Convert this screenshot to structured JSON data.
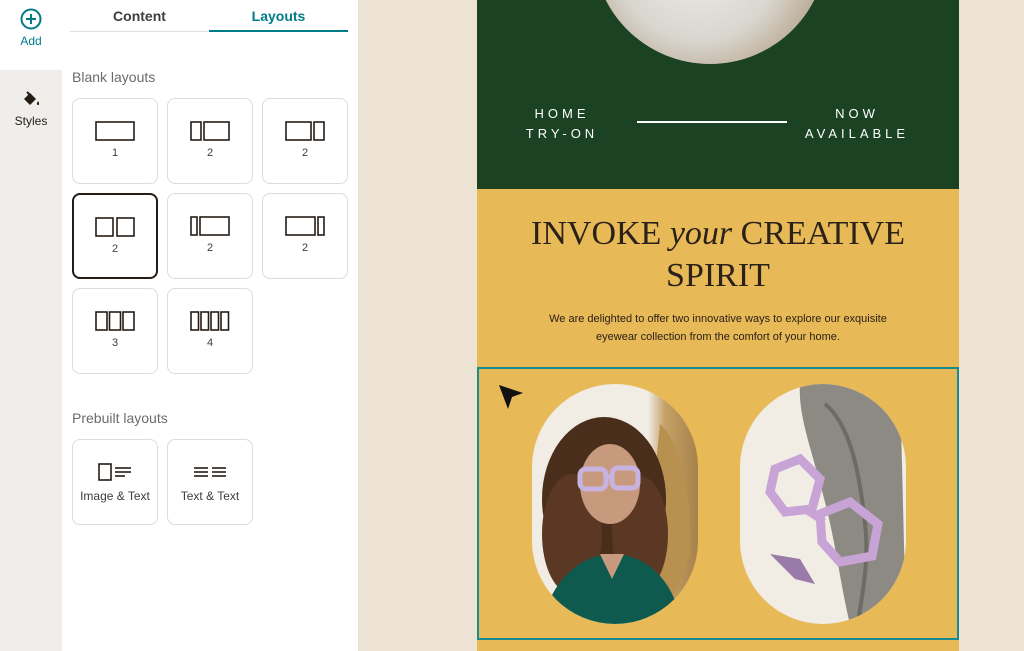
{
  "rail": {
    "add_label": "Add",
    "styles_label": "Styles",
    "accent": "#007c89"
  },
  "tabs": [
    {
      "label": "Content",
      "active": false
    },
    {
      "label": "Layouts",
      "active": true
    }
  ],
  "blank_layouts": {
    "title": "Blank layouts",
    "tiles": [
      {
        "label": "1",
        "icon": "layout-1-column-icon"
      },
      {
        "label": "2",
        "icon": "layout-2-column-left-narrow-icon"
      },
      {
        "label": "2",
        "icon": "layout-2-column-right-narrow-icon"
      },
      {
        "label": "2",
        "icon": "layout-2-column-equal-icon",
        "selected": true
      },
      {
        "label": "2",
        "icon": "layout-2-column-left-small-icon"
      },
      {
        "label": "2",
        "icon": "layout-2-column-right-small-icon"
      },
      {
        "label": "3",
        "icon": "layout-3-column-icon"
      },
      {
        "label": "4",
        "icon": "layout-4-column-icon"
      }
    ]
  },
  "prebuilt_layouts": {
    "title": "Prebuilt layouts",
    "tiles": [
      {
        "label": "Image & Text",
        "icon": "image-text-icon"
      },
      {
        "label": "Text & Text",
        "icon": "text-text-icon"
      }
    ]
  },
  "email": {
    "nav_left": "HOME\nTRY-ON",
    "nav_right": "NOW\nAVAILABLE",
    "headline_part1": "INVOKE ",
    "headline_italic": "your",
    "headline_part2": " CREATIVE SPIRIT",
    "subcopy": "We are delighted to offer two innovative ways to explore our exquisite eyewear collection from the comfort of your home.",
    "colors": {
      "green": "#1a4223",
      "yellow": "#e8b957",
      "selection": "#1a8a91",
      "canvas_bg": "#ede3d4"
    }
  }
}
